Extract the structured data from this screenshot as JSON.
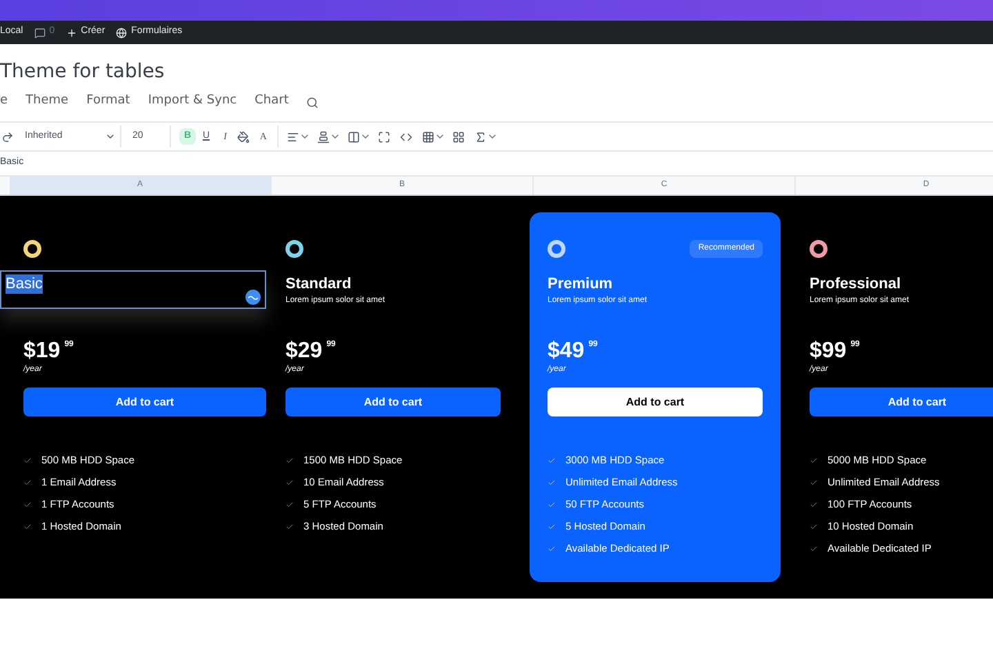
{
  "admin_bar": {
    "site": "Local",
    "comments": "0",
    "new": "Créer",
    "forms": "Formulaires"
  },
  "page_title": "Theme for tables",
  "menu": [
    {
      "label": "e"
    },
    {
      "label": "Theme"
    },
    {
      "label": "Format"
    },
    {
      "label": "Import & Sync"
    },
    {
      "label": "Chart"
    }
  ],
  "toolbar": {
    "font": "Inherited",
    "size": "20",
    "bold": true,
    "bold_label": "B",
    "underline_label": "U",
    "italic_label": "I",
    "text_color_label": "A"
  },
  "formula_bar": {
    "value": "Basic"
  },
  "columns": [
    {
      "label": "A",
      "selected": true
    },
    {
      "label": "B",
      "selected": false
    },
    {
      "label": "C",
      "selected": false
    },
    {
      "label": "D",
      "selected": false
    }
  ],
  "tiers": [
    {
      "title": "Basic",
      "editing": true,
      "color": "#f2d479",
      "featured": false,
      "price": "$19",
      "cents": "99",
      "period": "/year",
      "button": "Add to cart",
      "features": [
        "500 MB HDD Space",
        "1 Email Address",
        "1 FTP Accounts",
        "1 Hosted Domain"
      ]
    },
    {
      "title": "Standard",
      "editing": false,
      "subtitle": "Lorem ipsum solor sit amet",
      "color": "#7fd3e8",
      "featured": false,
      "price": "$29",
      "cents": "99",
      "period": "/year",
      "button": "Add to cart",
      "features": [
        "1500 MB HDD Space",
        "10 Email Address",
        "5 FTP Accounts",
        "3 Hosted Domain"
      ]
    },
    {
      "title": "Premium",
      "editing": false,
      "subtitle": "Lorem ipsum solor sit amet",
      "badge": "Recommended",
      "color": "#bcd6ff",
      "featured": true,
      "price": "$49",
      "cents": "99",
      "period": "/year",
      "button": "Add to cart",
      "features": [
        "3000 MB HDD Space",
        "Unlimited Email Address",
        "50 FTP Accounts",
        "5 Hosted Domain",
        "Available Dedicated IP"
      ]
    },
    {
      "title": "Professional",
      "editing": false,
      "subtitle": "Lorem ipsum solor sit amet",
      "color": "#f09aa5",
      "featured": false,
      "price": "$99",
      "cents": "99",
      "period": "/year",
      "button": "Add to cart",
      "features": [
        "5000 MB HDD Space",
        "Unlimited Email Address",
        "100 FTP Accounts",
        "10 Hosted Domain",
        "Available Dedicated IP"
      ]
    }
  ]
}
